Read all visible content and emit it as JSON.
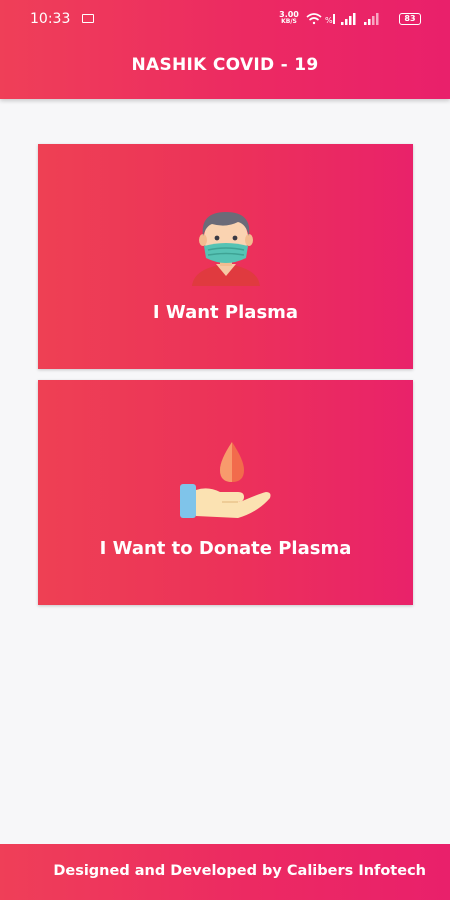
{
  "status_bar": {
    "time": "10:33",
    "speed_value": "3.00",
    "speed_unit": "KB/S",
    "battery": "83",
    "icons": [
      "screen-icon",
      "wifi-icon",
      "volte-icon",
      "signal-icon",
      "signal-icon",
      "battery-icon"
    ]
  },
  "header": {
    "title": "NASHIK COVID - 19"
  },
  "cards": [
    {
      "label": "I Want Plasma",
      "icon": "masked-person-icon"
    },
    {
      "label": "I Want to Donate Plasma",
      "icon": "blood-donation-hand-icon"
    }
  ],
  "footer": {
    "text": "Designed and Developed by Calibers Infotech"
  },
  "colors": {
    "primary": "#ec2a62",
    "primary_light": "#ef3f58",
    "background": "#f7f7f9"
  }
}
